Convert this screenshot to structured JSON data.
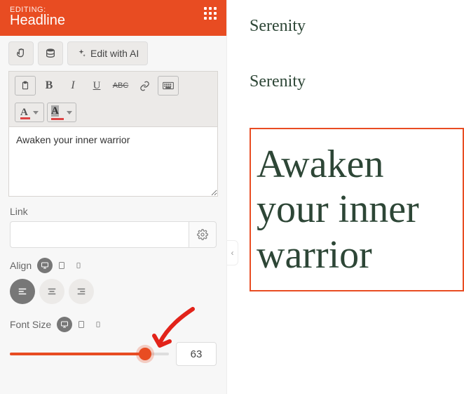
{
  "header": {
    "eyebrow": "EDITING:",
    "title": "Headline"
  },
  "ai_button": {
    "label": "Edit with AI"
  },
  "rte": {
    "content": "Awaken your inner warrior"
  },
  "link": {
    "label": "Link",
    "value": ""
  },
  "align": {
    "label": "Align"
  },
  "font_size": {
    "label": "Font Size",
    "value": "63"
  },
  "preview": {
    "brand1": "Serenity",
    "brand2": "Serenity",
    "headline": "Awaken your inner warrior"
  },
  "colors": {
    "accent": "#e84c22",
    "ink": "#2d4636"
  }
}
